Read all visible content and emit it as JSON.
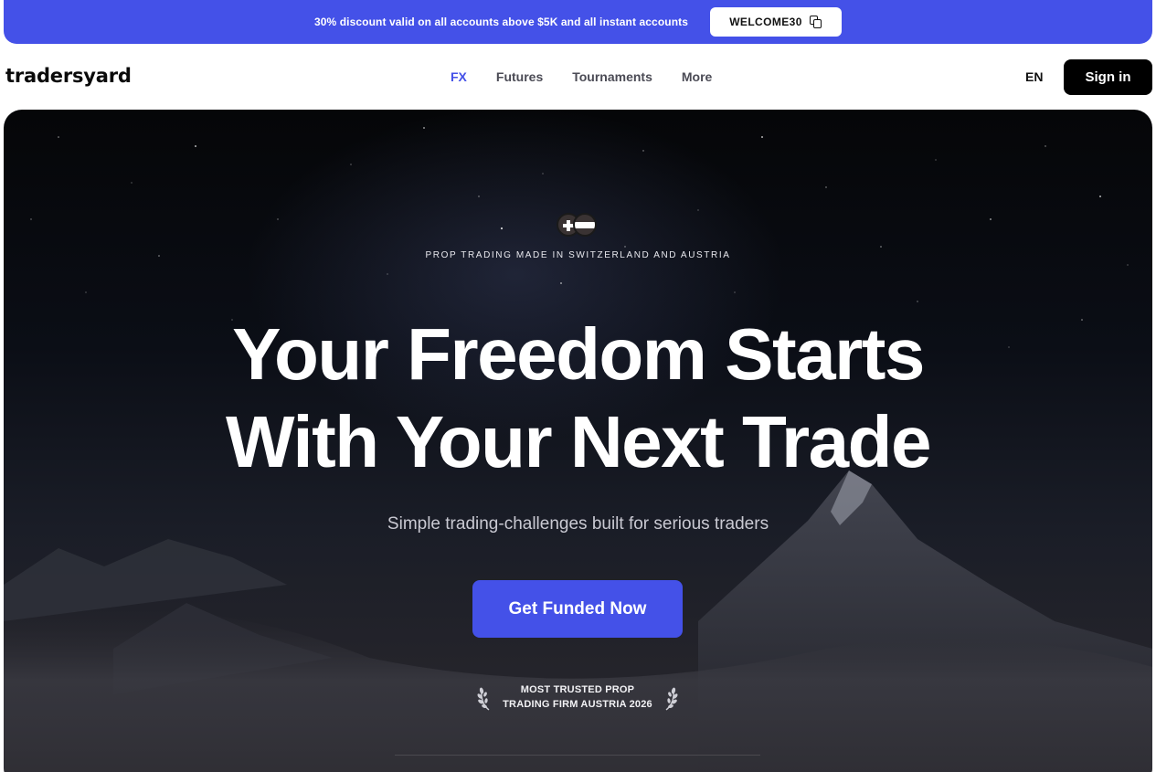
{
  "promo": {
    "text": "30% discount valid on all accounts above $5K and all instant accounts",
    "code": "WELCOME30"
  },
  "nav": {
    "logo": "tradersyard",
    "links": [
      "FX",
      "Futures",
      "Tournaments",
      "More"
    ],
    "active": "FX",
    "lang": "EN",
    "signin": "Sign in"
  },
  "hero": {
    "eyebrow": "PROP TRADING MADE IN SWITZERLAND AND AUSTRIA",
    "headline_line1": "Your Freedom Starts",
    "headline_line2": "With Your Next Trade",
    "subline": "Simple trading-challenges built for serious traders",
    "cta": "Get Funded Now",
    "award_line1": "MOST TRUSTED PROP",
    "award_line2": "TRADING FIRM AUSTRIA 2026"
  },
  "colors": {
    "accent": "#4451e8",
    "signin_bg": "#000000",
    "hero_bg": "#0b0e16"
  },
  "icons": [
    "copy-icon",
    "swiss-flag-icon",
    "austrian-flag-icon",
    "laurel-left-icon",
    "laurel-right-icon"
  ]
}
